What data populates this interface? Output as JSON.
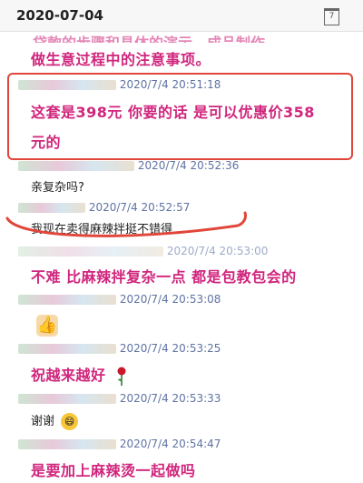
{
  "header": {
    "date": "2020-07-04",
    "calendar_icon": "calendar-icon",
    "calendar_day": "7"
  },
  "messages": {
    "cut_line": "贷款的步骤和具体的演示，成品制作",
    "line_a": "做生意过程中的注意事项。",
    "m1": {
      "time": "2020/7/4 20:51:18",
      "line1": "这套是398元 你要的话 是可以优惠价358",
      "line2": "元的"
    },
    "m2": {
      "time": "2020/7/4 20:52:36",
      "text": "亲复杂吗?"
    },
    "m3": {
      "time": "2020/7/4 20:52:57",
      "text": "我现在卖得麻辣拌挺不错得"
    },
    "m4": {
      "time": "2020/7/4 20:53:00",
      "text": "不难 比麻辣拌复杂一点 都是包教包会的"
    },
    "m5": {
      "time": "2020/7/4 20:53:08",
      "icon": "thumbs-up-icon"
    },
    "m6": {
      "time": "2020/7/4 20:53:25",
      "text": "祝越来越好",
      "icon": "rose-icon"
    },
    "m7": {
      "time": "2020/7/4 20:53:33",
      "text": "谢谢",
      "icon": "grin-emoji-icon"
    },
    "m8": {
      "time": "2020/7/4 20:54:47",
      "text": "是要加上麻辣烫一起做吗"
    }
  },
  "colors": {
    "accent_pink": "#d0267d",
    "meta_blue": "#5f73a4",
    "highlight_red": "#e0463a"
  }
}
